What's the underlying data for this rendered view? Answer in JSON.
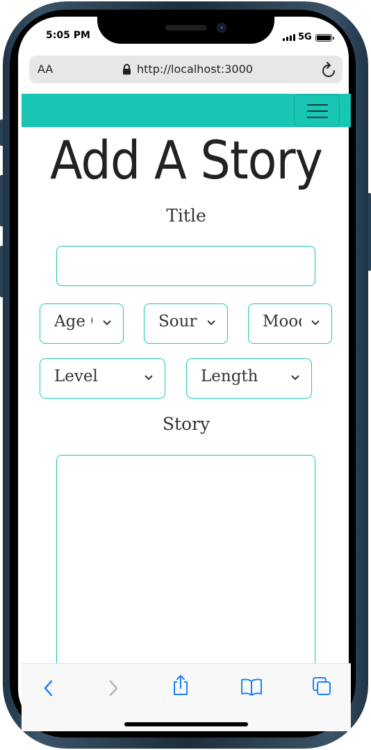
{
  "status_bar": {
    "time": "5:05 PM",
    "network": "5G"
  },
  "browser": {
    "text_size_label": "AA",
    "url": "http://localhost:3000"
  },
  "page": {
    "heading": "Add A Story",
    "title_label": "Title",
    "title_value": "",
    "selects": [
      {
        "label": "Age G"
      },
      {
        "label": "Source"
      },
      {
        "label": "Mood"
      },
      {
        "label": "Level"
      },
      {
        "label": "Length"
      }
    ],
    "story_label": "Story",
    "story_value": ""
  },
  "colors": {
    "accent": "#19c6b5",
    "ios_blue": "#1a82f7"
  },
  "toolbar_icons": [
    "back-icon",
    "forward-icon",
    "share-icon",
    "bookmarks-icon",
    "tabs-icon"
  ]
}
